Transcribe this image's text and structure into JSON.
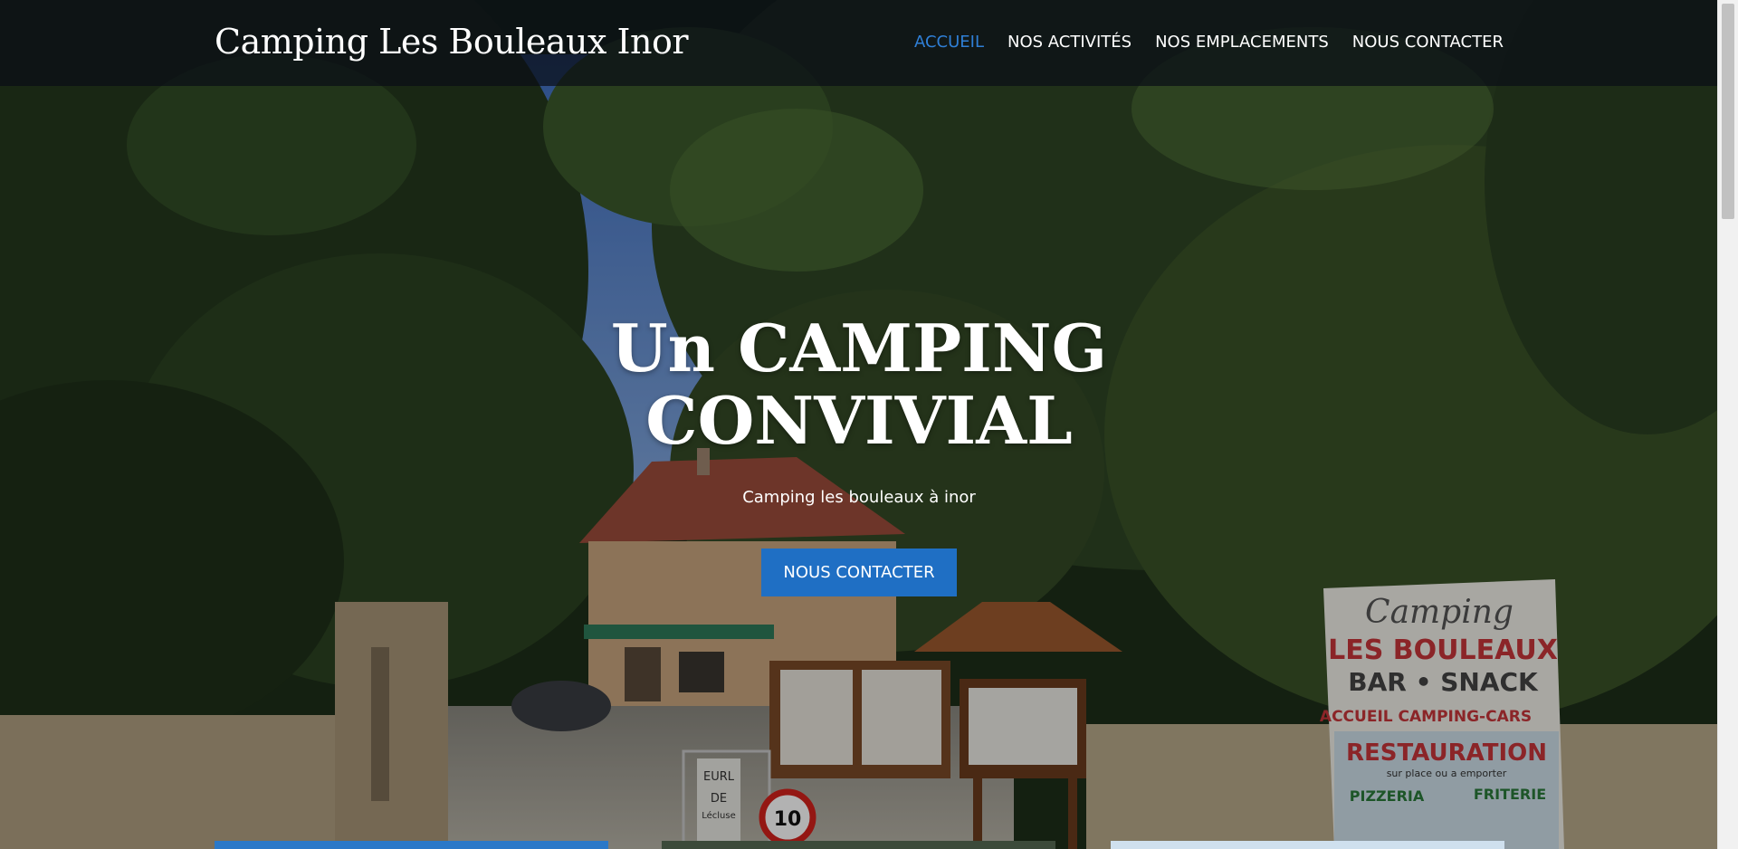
{
  "header": {
    "site_title": "Camping Les Bouleaux Inor",
    "nav": [
      {
        "label": "ACCUEIL",
        "active": true
      },
      {
        "label": "NOS ACTIVITÉS",
        "active": false
      },
      {
        "label": "NOS EMPLACEMENTS",
        "active": false
      },
      {
        "label": "NOUS CONTACTER",
        "active": false
      }
    ]
  },
  "hero": {
    "heading": "Un CAMPING CONVIVIAL",
    "subtitle": "Camping les bouleaux à inor",
    "cta_label": "NOUS CONTACTER"
  },
  "photo": {
    "sign": {
      "line1": "Camping",
      "line2": "LES BOULEAUX",
      "line3": "BAR • SNACK",
      "line4": "ACCUEIL CAMPING-CARS",
      "line5": "RESTAURATION",
      "line6": "sur place ou a emporter",
      "line7": "PIZZERIA",
      "line8": "FRITERIE"
    },
    "small_sign": {
      "line1": "EURL",
      "line2": "DE",
      "line3": "Lécluse"
    },
    "speed_sign": "10"
  },
  "colors": {
    "accent": "#1f6fc4",
    "nav_active": "#2f7fd6",
    "header_bg": "#0a0e16"
  }
}
